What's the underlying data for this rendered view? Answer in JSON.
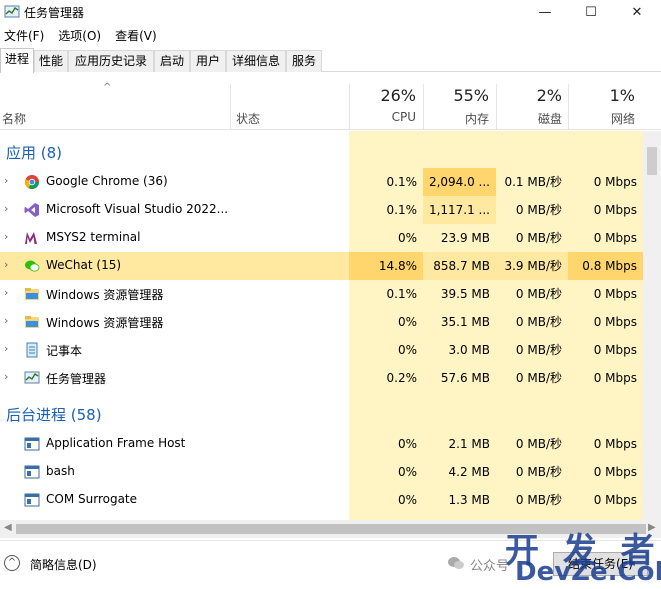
{
  "window": {
    "title": "任务管理器",
    "controls": {
      "minimize": "—",
      "maximize": "☐",
      "close": "✕"
    }
  },
  "menu": [
    "文件(F)",
    "选项(O)",
    "查看(V)"
  ],
  "tabs": [
    "进程",
    "性能",
    "应用历史记录",
    "启动",
    "用户",
    "详细信息",
    "服务"
  ],
  "header": {
    "name_label": "名称",
    "status_label": "状态",
    "columns": [
      {
        "pct": "26%",
        "label": "CPU"
      },
      {
        "pct": "55%",
        "label": "内存"
      },
      {
        "pct": "2%",
        "label": "磁盘"
      },
      {
        "pct": "1%",
        "label": "网络"
      }
    ]
  },
  "groups": {
    "apps": "应用 (8)",
    "background": "后台进程 (58)"
  },
  "apps": [
    {
      "name": "Google Chrome (36)",
      "icon": "chrome-icon",
      "cpu": "0.1%",
      "mem": "2,094.0 ...",
      "disk": "0.1 MB/秒",
      "net": "0 Mbps"
    },
    {
      "name": "Microsoft Visual Studio 2022...",
      "icon": "visual-studio-icon",
      "cpu": "0.1%",
      "mem": "1,117.1 ...",
      "disk": "0 MB/秒",
      "net": "0 Mbps"
    },
    {
      "name": "MSYS2 terminal",
      "icon": "msys2-icon",
      "cpu": "0%",
      "mem": "23.9 MB",
      "disk": "0 MB/秒",
      "net": "0 Mbps"
    },
    {
      "name": "WeChat (15)",
      "icon": "wechat-icon",
      "cpu": "14.8%",
      "mem": "858.7 MB",
      "disk": "3.9 MB/秒",
      "net": "0.8 Mbps"
    },
    {
      "name": "Windows 资源管理器",
      "icon": "explorer-icon",
      "cpu": "0.1%",
      "mem": "39.5 MB",
      "disk": "0 MB/秒",
      "net": "0 Mbps"
    },
    {
      "name": "Windows 资源管理器",
      "icon": "explorer-icon",
      "cpu": "0%",
      "mem": "35.1 MB",
      "disk": "0 MB/秒",
      "net": "0 Mbps"
    },
    {
      "name": "记事本",
      "icon": "notepad-icon",
      "cpu": "0%",
      "mem": "3.0 MB",
      "disk": "0 MB/秒",
      "net": "0 Mbps"
    },
    {
      "name": "任务管理器",
      "icon": "task-manager-icon",
      "cpu": "0.2%",
      "mem": "57.6 MB",
      "disk": "0 MB/秒",
      "net": "0 Mbps"
    }
  ],
  "background": [
    {
      "name": "Application Frame Host",
      "icon": "app-frame-icon",
      "cpu": "0%",
      "mem": "2.1 MB",
      "disk": "0 MB/秒",
      "net": "0 Mbps"
    },
    {
      "name": "bash",
      "icon": "bash-icon",
      "cpu": "0%",
      "mem": "4.2 MB",
      "disk": "0 MB/秒",
      "net": "0 Mbps"
    },
    {
      "name": "COM Surrogate",
      "icon": "com-surrogate-icon",
      "cpu": "0%",
      "mem": "1.3 MB",
      "disk": "0 MB/秒",
      "net": "0 Mbps"
    }
  ],
  "footer": {
    "fewer_details": "简略信息(D)",
    "end_task": "结束任务(E)",
    "watermark_small": "公众号",
    "watermark_big": "开 发 者",
    "watermark_url": "DevZe.CoM"
  },
  "colors": {
    "heat_light": "#fff4c4",
    "heat_medium": "#ffe8a0",
    "heat_strong": "#ffd66e",
    "group_blue": "#1a5fb4"
  }
}
